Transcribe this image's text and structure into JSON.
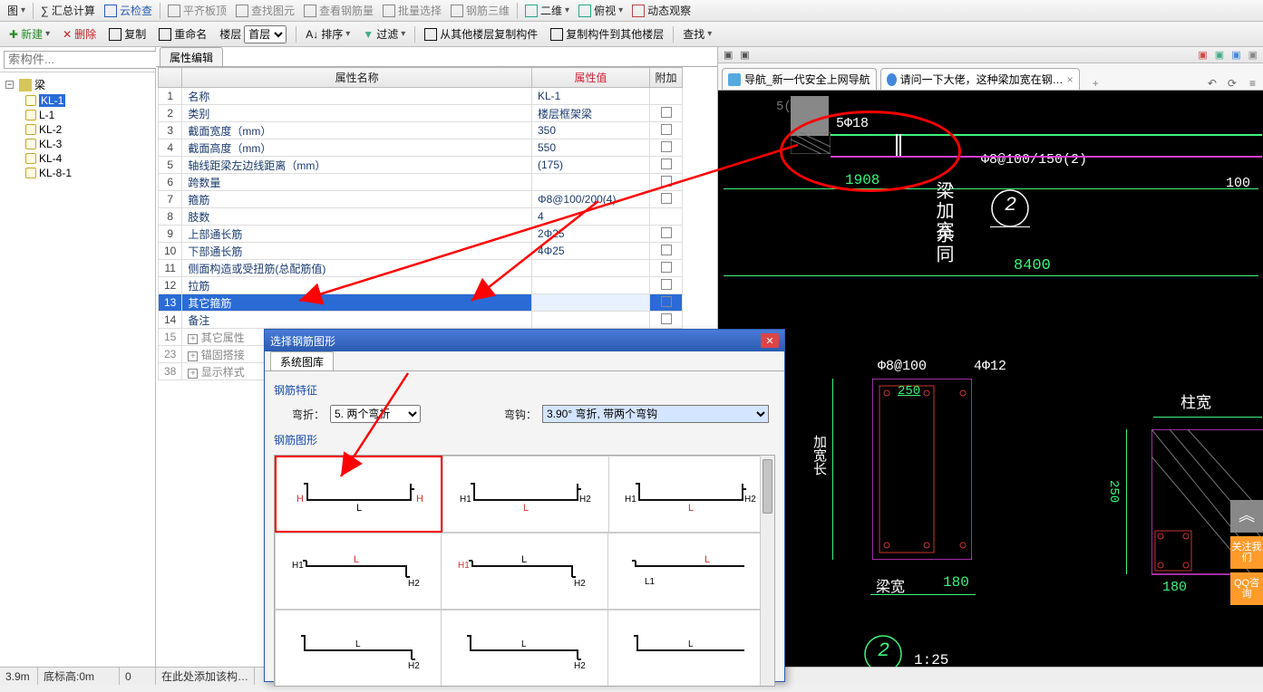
{
  "topbar": [
    {
      "label": "图",
      "name": "view"
    },
    {
      "label": "∑ 汇总计算",
      "name": "sum-calc"
    },
    {
      "label": "云检查",
      "name": "cloud-check"
    },
    {
      "label": "平齐板顶",
      "name": "align-top"
    },
    {
      "label": "查找图元",
      "name": "find-elem"
    },
    {
      "label": "查看钢筋量",
      "name": "view-rebar"
    },
    {
      "label": "批量选择",
      "name": "batch-select"
    },
    {
      "label": "钢筋三维",
      "name": "rebar-3d"
    },
    {
      "label": "二维",
      "name": "2d"
    },
    {
      "label": "俯视",
      "name": "top-view"
    },
    {
      "label": "动态观察",
      "name": "dynamic-view"
    }
  ],
  "toolbar2": {
    "new": "新建",
    "del": "删除",
    "copy": "复制",
    "rename": "重命名",
    "floor_label": "楼层",
    "floor_value": "首层",
    "sort": "排序",
    "filter": "过滤",
    "copyFromOther": "从其他楼层复制构件",
    "copyToOther": "复制构件到其他楼层",
    "find": "查找"
  },
  "search_placeholder": "索构件...",
  "tree": {
    "root": "梁",
    "items": [
      "KL-1",
      "L-1",
      "KL-2",
      "KL-3",
      "KL-4",
      "KL-8-1"
    ]
  },
  "tab_label": "属性编辑",
  "grid": {
    "headers": {
      "name": "属性名称",
      "value": "属性值",
      "add": "附加"
    },
    "rows": [
      {
        "idx": "1",
        "name": "名称",
        "value": "KL-1",
        "add": ""
      },
      {
        "idx": "2",
        "name": "类别",
        "value": "楼层框架梁",
        "add": "chk"
      },
      {
        "idx": "3",
        "name": "截面宽度（mm）",
        "value": "350",
        "add": "chk"
      },
      {
        "idx": "4",
        "name": "截面高度（mm）",
        "value": "550",
        "add": "chk"
      },
      {
        "idx": "5",
        "name": "轴线距梁左边线距离（mm）",
        "value": "(175)",
        "add": "chk"
      },
      {
        "idx": "6",
        "name": "跨数量",
        "value": "",
        "add": "chk"
      },
      {
        "idx": "7",
        "name": "箍筋",
        "value": "Φ8@100/200(4)",
        "add": "chk"
      },
      {
        "idx": "8",
        "name": "肢数",
        "value": "4",
        "add": ""
      },
      {
        "idx": "9",
        "name": "上部通长筋",
        "value": "2Φ25",
        "add": "chk"
      },
      {
        "idx": "10",
        "name": "下部通长筋",
        "value": "4Φ25",
        "add": "chk"
      },
      {
        "idx": "11",
        "name": "侧面构造或受扭筋(总配筋值)",
        "value": "",
        "add": "chk"
      },
      {
        "idx": "12",
        "name": "拉筋",
        "value": "",
        "add": "chk"
      },
      {
        "idx": "13",
        "name": "其它箍筋",
        "value": "",
        "add": "chk",
        "sel": true
      },
      {
        "idx": "14",
        "name": "备注",
        "value": "",
        "add": "chk"
      },
      {
        "idx": "15",
        "name": "其它属性",
        "value": "",
        "add": "",
        "grey": true,
        "plus": true
      },
      {
        "idx": "23",
        "name": "锚固搭接",
        "value": "",
        "add": "",
        "grey": true,
        "plus": true
      },
      {
        "idx": "38",
        "name": "显示样式",
        "value": "",
        "add": "",
        "grey": true,
        "plus": true
      }
    ]
  },
  "dialog": {
    "title": "选择钢筋图形",
    "tab": "系统图库",
    "group1": "钢筋特征",
    "bend_label": "弯折：",
    "bend_value": "5. 两个弯折",
    "hook_label": "弯钩：",
    "hook_value": "3.90° 弯折, 带两个弯钩",
    "group2": "钢筋图形"
  },
  "browser": {
    "tabs": [
      {
        "label": "导航_新一代安全上网导航"
      },
      {
        "label": "请问一下大佬，这种梁加宽在钢…"
      }
    ]
  },
  "cad": {
    "t1": "5Φ18",
    "t2": "Φ8@100/150(2)",
    "t3": "1908",
    "t4": "梁加宽",
    "t5": "余同",
    "t6": "2",
    "t7": "8400",
    "t8": "100",
    "t9": "5(",
    "s1": "Φ8@100",
    "s2": "4Φ12",
    "s3": "250",
    "s4": "梁宽",
    "s5": "180",
    "s6": "加宽长",
    "s7": "1:25",
    "s8": "柱宽",
    "s9": "250",
    "s10": "180"
  },
  "status": {
    "c1": "3.9m",
    "c2": "底标高:0m",
    "c3": "0",
    "c4": "在此处添加该构…"
  },
  "float": {
    "top": "︽",
    "b1": "关注我们",
    "b2": "QQ咨询"
  }
}
